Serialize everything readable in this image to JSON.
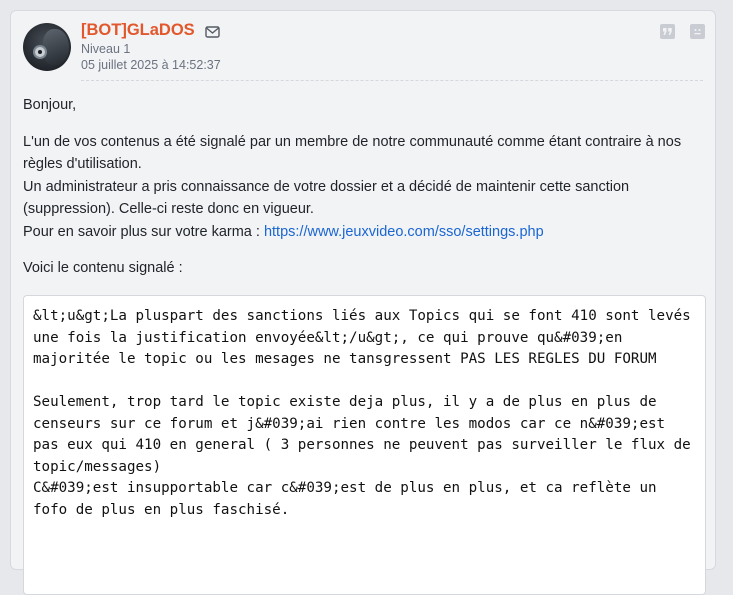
{
  "post": {
    "username": "[BOT]GLaDOS",
    "level": "Niveau 1",
    "date": "05 juillet 2025 à 14:52:37",
    "icons": {
      "mail": "mail-icon",
      "quote": "quote-icon",
      "report": "report-icon"
    },
    "colors": {
      "username": "#e2582c",
      "link": "#1a66d2"
    }
  },
  "message": {
    "greeting": "Bonjour,",
    "para1_line1": "L'un de vos contenus a été signalé par un membre de notre communauté comme étant contraire à nos règles d'utilisation.",
    "para1_line2": "Un administrateur a pris connaissance de votre dossier et a décidé de maintenir cette sanction (suppression). Celle-ci reste donc en vigueur.",
    "para1_line3_prefix": "Pour en savoir plus sur votre karma : ",
    "karma_link": "https://www.jeuxvideo.com/sso/settings.php",
    "reported_intro": "Voici le contenu signalé :"
  },
  "reported_content": {
    "text": "&lt;u&gt;La pluspart des sanctions liés aux Topics qui se font 410 sont levés une fois la justification envoyée&lt;/u&gt;, ce qui prouve qu&#039;en majoritée le topic ou les mesages ne tansgressent PAS LES REGLES DU FORUM\n\nSeulement, trop tard le topic existe deja plus, il y a de plus en plus de censeurs sur ce forum et j&#039;ai rien contre les modos car ce n&#039;est pas eux qui 410 en general ( 3 personnes ne peuvent pas surveiller le flux de topic/messages)\nC&#039;est insupportable car c&#039;est de plus en plus, et ca reflète un fofo de plus en plus faschisé."
  }
}
